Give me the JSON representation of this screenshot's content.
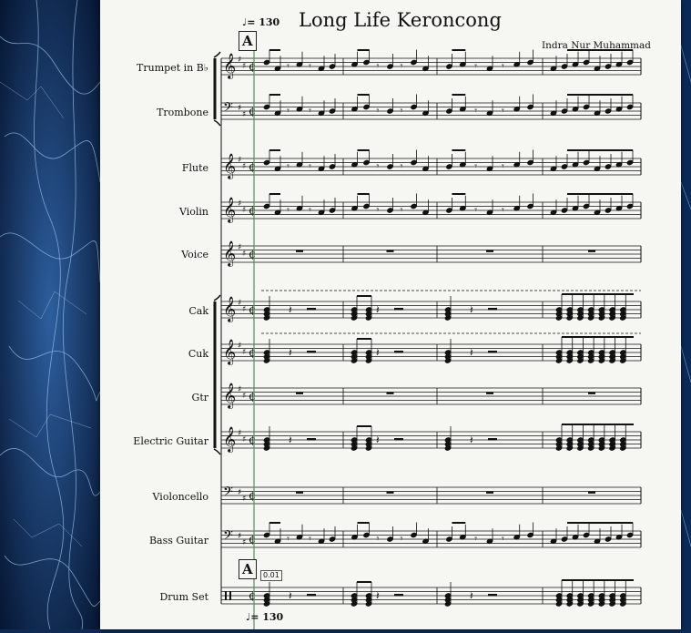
{
  "score": {
    "title": "Long Life Keroncong",
    "composer": "Indra Nur Muhammad",
    "tempo_top": "♩= 130",
    "tempo_bottom": "♩= 130",
    "rehearsal_mark": "A",
    "timing_marker": "0.01",
    "instruments": [
      {
        "name": "Trumpet in B♭",
        "clef": "treble",
        "key_sharps": 2
      },
      {
        "name": "Trombone",
        "clef": "bass",
        "key_sharps": 2
      },
      {
        "name": "Flute",
        "clef": "treble",
        "key_sharps": 2
      },
      {
        "name": "Violin",
        "clef": "treble",
        "key_sharps": 2
      },
      {
        "name": "Voice",
        "clef": "treble",
        "key_sharps": 2
      },
      {
        "name": "Cak",
        "clef": "treble",
        "key_sharps": 2
      },
      {
        "name": "Cuk",
        "clef": "treble",
        "key_sharps": 2
      },
      {
        "name": "Gtr",
        "clef": "treble",
        "key_sharps": 2
      },
      {
        "name": "Electric Guitar",
        "clef": "treble",
        "key_sharps": 2
      },
      {
        "name": "Violoncello",
        "clef": "bass",
        "key_sharps": 2
      },
      {
        "name": "Bass Guitar",
        "clef": "bass",
        "key_sharps": 2
      },
      {
        "name": "Drum Set",
        "clef": "percussion",
        "key_sharps": 0
      }
    ],
    "time_signature": "cut-time",
    "measures": 4,
    "colors": {
      "paper": "#f6f6f3",
      "ink": "#111111",
      "cursor": "#4a9a4a",
      "background": "#0e2a55"
    }
  }
}
